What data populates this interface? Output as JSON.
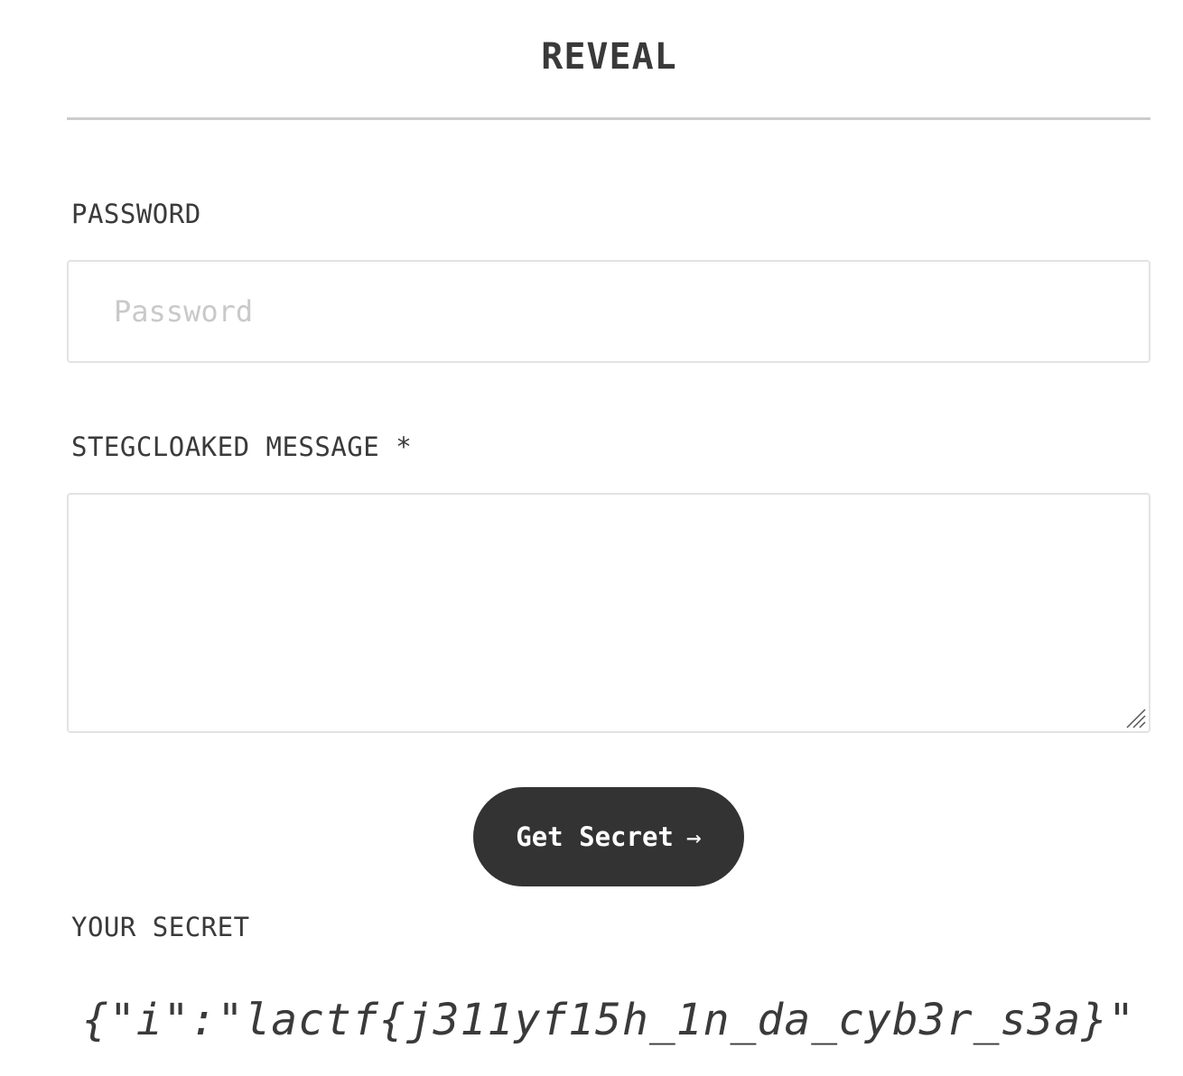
{
  "header": {
    "title": "REVEAL"
  },
  "password": {
    "label": "PASSWORD",
    "placeholder": "Password",
    "value": ""
  },
  "message": {
    "label": "STEGCLOAKED MESSAGE *",
    "value": ""
  },
  "action": {
    "button_label": "Get Secret",
    "arrow": "→"
  },
  "result": {
    "label": "YOUR SECRET",
    "value": "{\"i\":\"lactf{j311yf15h_1n_da_cyb3r_s3a}\""
  },
  "colors": {
    "button_bg": "#333333",
    "text": "#3a3a3a",
    "divider": "#cccccc",
    "input_border": "#e3e3e3"
  }
}
